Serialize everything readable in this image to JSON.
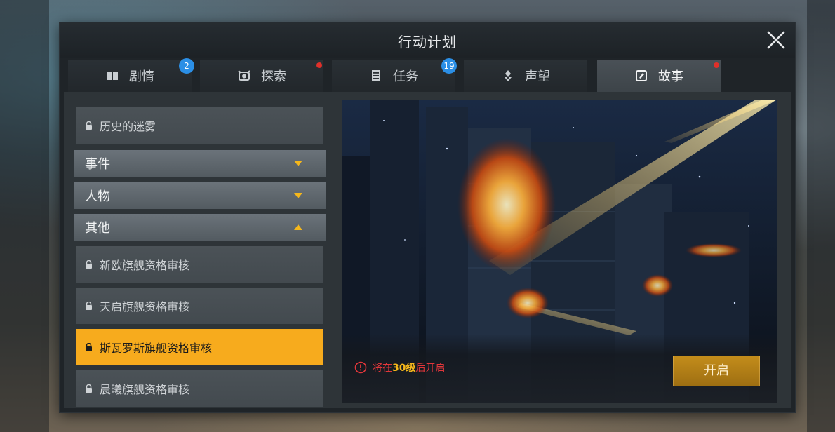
{
  "window": {
    "title": "行动计划",
    "close_icon": "close-icon"
  },
  "tabs": [
    {
      "label": "剧情",
      "icon": "book-icon",
      "badge": "2",
      "dot": false,
      "active": false
    },
    {
      "label": "探索",
      "icon": "explore-icon",
      "badge": "",
      "dot": true,
      "active": false
    },
    {
      "label": "任务",
      "icon": "task-icon",
      "badge": "19",
      "dot": false,
      "active": false
    },
    {
      "label": "声望",
      "icon": "reputation-icon",
      "badge": "",
      "dot": false,
      "active": false
    },
    {
      "label": "故事",
      "icon": "story-icon",
      "badge": "",
      "dot": true,
      "active": true
    }
  ],
  "sidebar": {
    "items": [
      {
        "kind": "entry",
        "label": "历史的迷雾",
        "locked": true
      },
      {
        "kind": "category",
        "label": "事件",
        "expanded": false
      },
      {
        "kind": "category",
        "label": "人物",
        "expanded": false
      },
      {
        "kind": "category",
        "label": "其他",
        "expanded": true
      },
      {
        "kind": "entry",
        "label": "新欧旗舰资格审核",
        "locked": true
      },
      {
        "kind": "entry",
        "label": "天启旗舰资格审核",
        "locked": true
      },
      {
        "kind": "entry",
        "label": "斯瓦罗斯旗舰资格审核",
        "locked": true,
        "selected": true
      },
      {
        "kind": "entry",
        "label": "晨曦旗舰资格审核",
        "locked": true
      }
    ]
  },
  "preview": {
    "note_prefix": "将在",
    "note_level": "30级",
    "note_suffix": "后开启",
    "open_label": "开启",
    "warning_icon": "warning-icon",
    "image": "space-battle-illustration"
  },
  "colors": {
    "accent": "#f7ab1d",
    "badge": "#2b8fe6",
    "alert": "#e0363a"
  }
}
